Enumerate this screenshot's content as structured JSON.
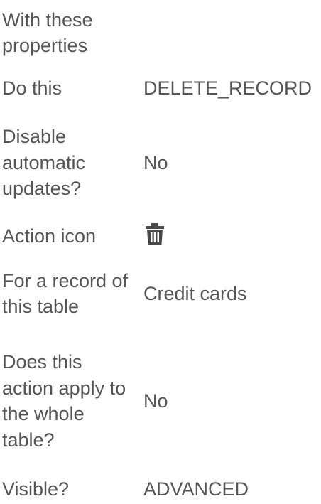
{
  "rows": [
    {
      "label": "With these properties",
      "value": ""
    },
    {
      "label": "Do this",
      "value": "DELETE_RECORD"
    },
    {
      "label": "Disable automatic updates?",
      "value": "No"
    },
    {
      "label": "Action icon",
      "icon": "trash-icon"
    },
    {
      "label": "For a record of this table",
      "value": "Credit cards"
    },
    {
      "label": "Does this action apply to the whole table?",
      "value": "No"
    },
    {
      "label": "Visible?",
      "value": "ADVANCED"
    }
  ],
  "colors": {
    "text": "#555555",
    "icon": "#4a4a4a"
  }
}
